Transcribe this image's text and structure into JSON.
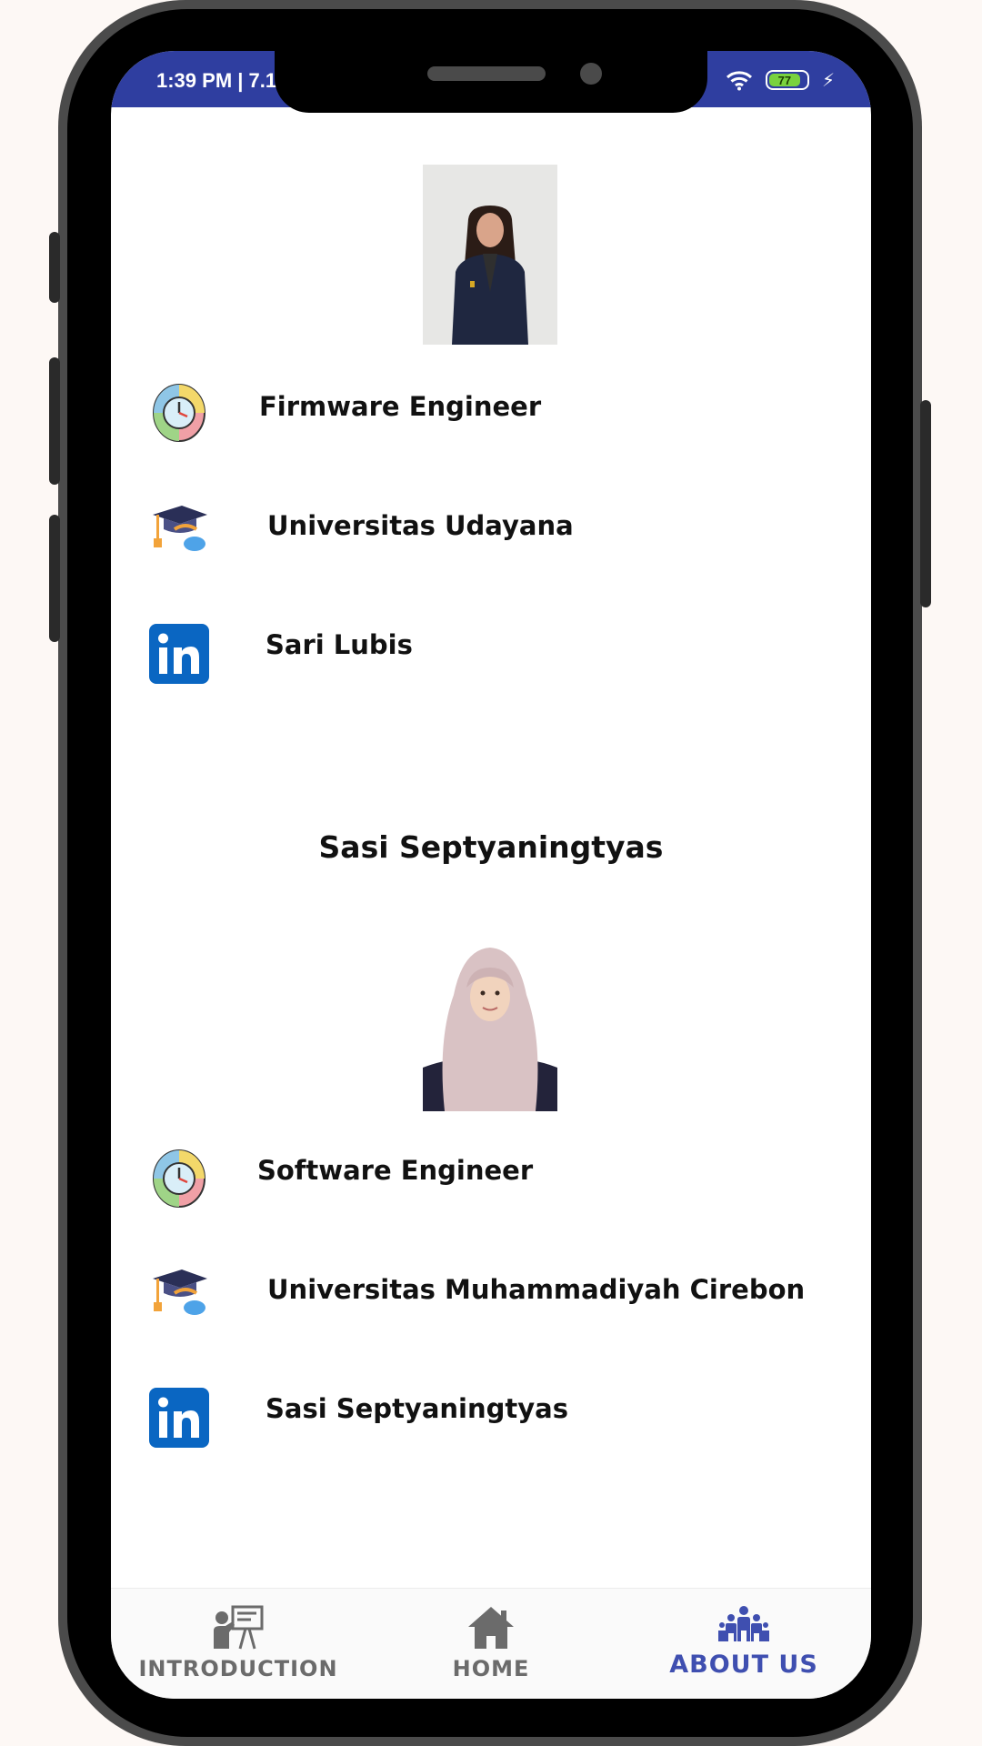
{
  "status_bar": {
    "time": "1:39 PM | 7.1",
    "battery_level": "77"
  },
  "profiles": [
    {
      "name": "",
      "role": "Firmware Engineer",
      "university": "Universitas Udayana",
      "linkedin": "Sari Lubis"
    },
    {
      "name": "Sasi Septyaningtyas",
      "role": "Software Engineer",
      "university": "Universitas Muhammadiyah Cirebon",
      "linkedin": "Sasi Septyaningtyas"
    }
  ],
  "nav": [
    {
      "label": "INTRODUCTION",
      "icon": "presentation-icon",
      "active": false
    },
    {
      "label": "HOME",
      "icon": "home-icon",
      "active": false
    },
    {
      "label": "ABOUT US",
      "icon": "group-icon",
      "active": true
    }
  ],
  "colors": {
    "accent": "#3f4fb0",
    "statusbar": "#2f3ea0",
    "linkedin": "#0a66c2",
    "inactive": "#6b6b6b"
  }
}
